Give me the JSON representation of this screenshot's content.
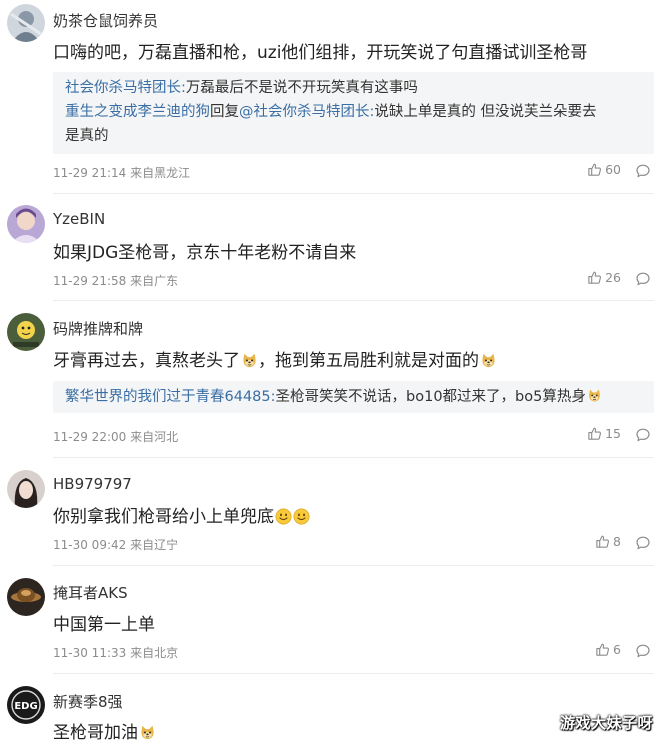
{
  "comments": [
    {
      "user": "奶茶仓鼠饲养员",
      "text": "口嗨的吧，万磊直播和枪，uzi他们组排，开玩笑说了句直播试训圣枪哥",
      "quote": {
        "line1_user": "社会你杀马特团长:",
        "line1_text": "万磊最后不是说不开玩笑真有这事吗",
        "line2_user": "重生之变成李兰迪的狗",
        "line2_mid": "回复",
        "line2_user2": "@社会你杀马特团长:",
        "line2_text": "说缺上单是真的 但没说芙兰朵要去",
        "line3_text": "是真的"
      },
      "meta": "11-29 21:14 来自黑龙江",
      "likes": "60"
    },
    {
      "user": "YzeBIN",
      "text": "如果JDG圣枪哥，京东十年老粉不请自来",
      "meta": "11-29 21:58 来自广东",
      "likes": "26"
    },
    {
      "user": "码牌推牌和牌",
      "text_a": "牙膏再过去，真熬老头了",
      "text_b": "，拖到第五局胜利就是对面的",
      "quote": {
        "line1_user": "繁华世界的我们过于青春64485:",
        "line1_text": "圣枪哥笑笑不说话，bo10都过来了，bo5算热身"
      },
      "meta": "11-29 22:00 来自河北",
      "likes": "15"
    },
    {
      "user": "HB979797",
      "text": "你别拿我们枪哥给小上单兜底",
      "meta": "11-30 09:42 来自辽宁",
      "likes": "8"
    },
    {
      "user": "掩耳者AKS",
      "text": "中国第一上单",
      "meta": "11-30 11:33 来自北京",
      "likes": "6"
    },
    {
      "user": "新赛季8强",
      "text": "圣枪哥加油"
    }
  ],
  "avatar_labels": {
    "c6": "EDG"
  },
  "watermark": "游戏大妹子呀",
  "icons": {
    "like": "thumb-up-icon",
    "reply": "comment-bubble-icon",
    "emoji_doge": "doge-emoji-icon",
    "emoji_smile": "smile-emoji-icon"
  },
  "colors": {
    "link": "#3a6ea5",
    "meta": "#8c8c8c",
    "quote_bg": "#f4f5f6"
  }
}
